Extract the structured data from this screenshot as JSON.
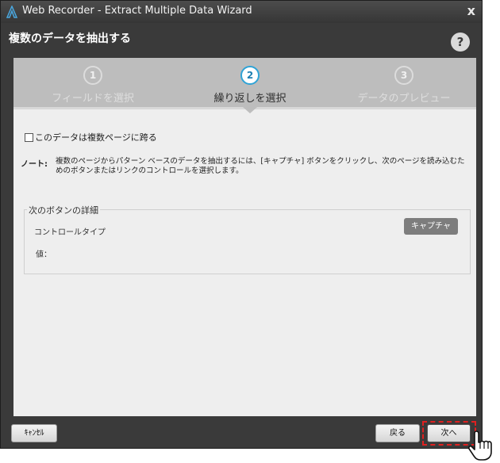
{
  "window": {
    "title": "Web Recorder - Extract Multiple Data Wizard",
    "close_symbol": "x",
    "heading": "複数のデータを抽出する",
    "help_symbol": "?"
  },
  "steps": [
    {
      "number": "1",
      "label": "フィールドを選択",
      "active": false
    },
    {
      "number": "2",
      "label": "繰り返しを選択",
      "active": true
    },
    {
      "number": "3",
      "label": "データのプレビュー",
      "active": false
    }
  ],
  "options": {
    "multi_page_label": "このデータは複数ページに跨る",
    "multi_page_checked": false
  },
  "note": {
    "label": "ノート:",
    "text": "複数のページからパターン ベースのデータを抽出するには、[キャプチャ] ボタンをクリックし、次のページを読み込むためのボタンまたはリンクのコントロールを選択します。"
  },
  "next_button_details": {
    "title": "次のボタンの詳細",
    "control_type_label": "コントロールタイプ",
    "value_label": "値：",
    "capture_label": "キャプチャ"
  },
  "footer": {
    "cancel_label": "ｷｬﾝｾﾙ",
    "back_label": "戻る",
    "next_label": "次へ"
  },
  "icons": {
    "app": "automation-anywhere-logo-icon",
    "help": "help-icon",
    "cursor": "hand-pointer-icon"
  },
  "colors": {
    "window_bg": "#3a3a3a",
    "step_active": "#2fa3d6",
    "highlight": "#e02020"
  }
}
